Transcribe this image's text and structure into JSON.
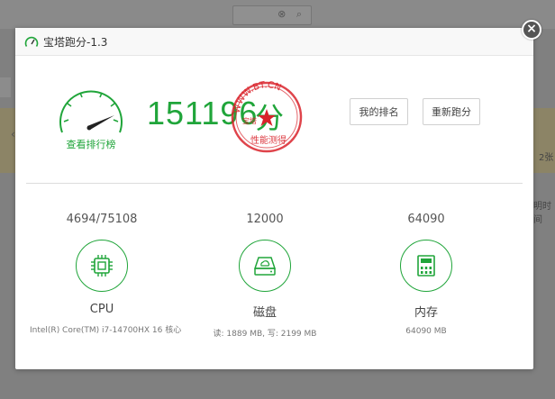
{
  "dialog": {
    "title": "宝塔跑分-1.3",
    "close_symbol": "×"
  },
  "score": {
    "value": "151196",
    "unit": "分",
    "rank_link": "查看排行榜",
    "seal_text_top": "WWW.BT.CN",
    "seal_text_left": "宝塔",
    "seal_text_bottom": "性能测得"
  },
  "buttons": {
    "my_rank": "我的排名",
    "retest": "重新跑分"
  },
  "metrics": [
    {
      "value": "4694/75108",
      "label": "CPU",
      "detail": "Intel(R) Core(TM) i7-14700HX 16 核心",
      "icon": "cpu-icon"
    },
    {
      "value": "12000",
      "label": "磁盘",
      "detail": "读: 1889 MB, 写: 2199 MB",
      "icon": "disk-icon"
    },
    {
      "value": "64090",
      "label": "内存",
      "detail": "64090 MB",
      "icon": "memory-icon"
    }
  ],
  "background": {
    "right_text_1": "2张",
    "right_text_2": "明时间"
  },
  "colors": {
    "accent": "#20a53a",
    "seal": "#d9232b"
  }
}
